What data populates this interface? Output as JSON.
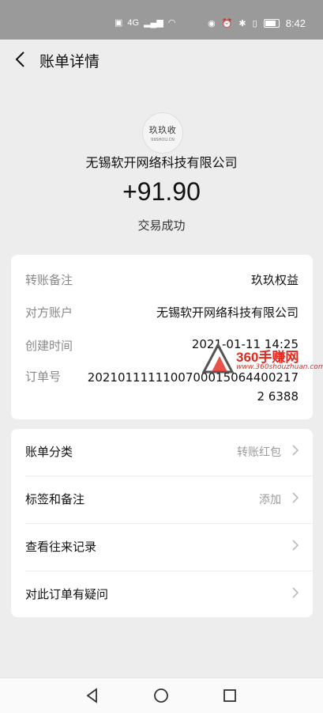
{
  "statusbar": {
    "network": "4G",
    "time": "8:42"
  },
  "navbar": {
    "title": "账单详情"
  },
  "header": {
    "logo_text": "玖玖收",
    "logo_sub": "99SHOU.CN",
    "merchant": "无锡软开网络科技有限公司",
    "amount": "+91.90",
    "status": "交易成功"
  },
  "details": [
    {
      "label": "转账备注",
      "value": "玖玖权益"
    },
    {
      "label": "对方账户",
      "value": "无锡软开网络科技有限公司"
    },
    {
      "label": "创建时间",
      "value": "2021-01-11 14:25"
    },
    {
      "label": "订单号",
      "value": "20210111111007000150644002172 6388"
    }
  ],
  "actions": [
    {
      "label": "账单分类",
      "value": "转账红包"
    },
    {
      "label": "标签和备注",
      "value": "添加"
    },
    {
      "label": "查看往来记录",
      "value": ""
    },
    {
      "label": "对此订单有疑问",
      "value": ""
    }
  ],
  "watermark": {
    "text": "360手赚网",
    "url": "www.360shouzhuan.com",
    "color": "#e3261c"
  },
  "colors": {
    "statusbar_bg": "#9a9a9a",
    "page_bg": "#ededed",
    "card_bg": "#ffffff"
  }
}
